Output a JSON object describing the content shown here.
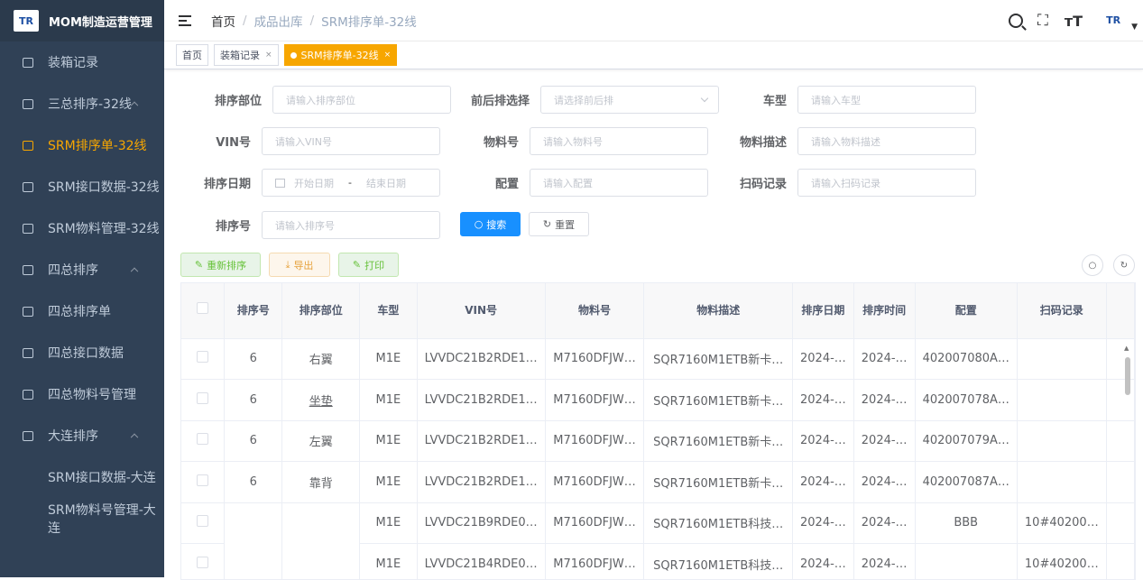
{
  "app": {
    "logo_text": "TR",
    "title": "MOM制造运营管理"
  },
  "sidebar": {
    "items": [
      {
        "label": "装箱记录"
      },
      {
        "label": "三总排序-32线"
      },
      {
        "label": "SRM排序单-32线"
      },
      {
        "label": "SRM接口数据-32线"
      },
      {
        "label": "SRM物料管理-32线"
      },
      {
        "label": "四总排序"
      },
      {
        "label": "四总排序单"
      },
      {
        "label": "四总接口数据"
      },
      {
        "label": "四总物料号管理"
      },
      {
        "label": "大连排序"
      },
      {
        "label": "SRM接口数据-大连"
      },
      {
        "label": "SRM物料号管理-大连"
      }
    ]
  },
  "breadcrumb": {
    "home": "首页",
    "sep": "/",
    "level1": "成品出库",
    "level2": "SRM排序单-32线"
  },
  "navbar": {
    "avatar_text": "TR"
  },
  "tags": [
    {
      "label": "首页"
    },
    {
      "label": "装箱记录",
      "close": "×"
    },
    {
      "label": "SRM排序单-32线",
      "close": "×"
    }
  ],
  "form": {
    "sort_dept": {
      "label": "排序部位",
      "placeholder": "请输入排序部位"
    },
    "front_back": {
      "label": "前后排选择",
      "placeholder": "请选择前后排"
    },
    "car_model": {
      "label": "车型",
      "placeholder": "请输入车型"
    },
    "vin": {
      "label": "VIN号",
      "placeholder": "请输入VIN号"
    },
    "material_no": {
      "label": "物料号",
      "placeholder": "请输入物料号"
    },
    "material_desc": {
      "label": "物料描述",
      "placeholder": "请输入物料描述"
    },
    "sort_date": {
      "label": "排序日期",
      "start": "开始日期",
      "dash": "-",
      "end": "结束日期"
    },
    "config": {
      "label": "配置",
      "placeholder": "请输入配置"
    },
    "scan_record": {
      "label": "扫码记录",
      "placeholder": "请输入扫码记录"
    },
    "sort_no": {
      "label": "排序号",
      "placeholder": "请输入排序号"
    },
    "search_button": "搜索",
    "reset_button": "重置"
  },
  "toolbar": {
    "resort": "重新排序",
    "export": "导出",
    "print": "打印"
  },
  "table": {
    "columns": [
      "排序号",
      "排序部位",
      "车型",
      "VIN号",
      "物料号",
      "物料描述",
      "排序日期",
      "排序时间",
      "配置",
      "扫码记录"
    ],
    "rows": [
      [
        "6",
        "右翼",
        "M1E",
        "LVVDC21B2RDE1…",
        "M7160DFJW…",
        "SQR7160M1ETB新卡…",
        "2024-…",
        "2024-…",
        "402007080A…",
        ""
      ],
      [
        "6",
        "坐垫",
        "M1E",
        "LVVDC21B2RDE1…",
        "M7160DFJW…",
        "SQR7160M1ETB新卡…",
        "2024-…",
        "2024-…",
        "402007078A…",
        ""
      ],
      [
        "6",
        "左翼",
        "M1E",
        "LVVDC21B2RDE1…",
        "M7160DFJW…",
        "SQR7160M1ETB新卡…",
        "2024-…",
        "2024-…",
        "402007079A…",
        ""
      ],
      [
        "6",
        "靠背",
        "M1E",
        "LVVDC21B2RDE1…",
        "M7160DFJW…",
        "SQR7160M1ETB新卡…",
        "2024-…",
        "2024-…",
        "402007087A…",
        ""
      ],
      [
        "",
        "",
        "M1E",
        "LVVDC21B9RDE0…",
        "M7160DFJW…",
        "SQR7160M1ETB科技…",
        "2024-…",
        "2024-…",
        "BBB",
        "10#40200…"
      ],
      [
        "",
        "",
        "M1E",
        "LVVDC21B4RDE0…",
        "M7160DFJW…",
        "SQR7160M1ETB科技…",
        "2024-…",
        "2024-…",
        "",
        "10#40200…"
      ]
    ]
  },
  "colors": {
    "sidebar_bg": "#304156",
    "accent": "#f7a600",
    "primary": "#1890ff"
  }
}
